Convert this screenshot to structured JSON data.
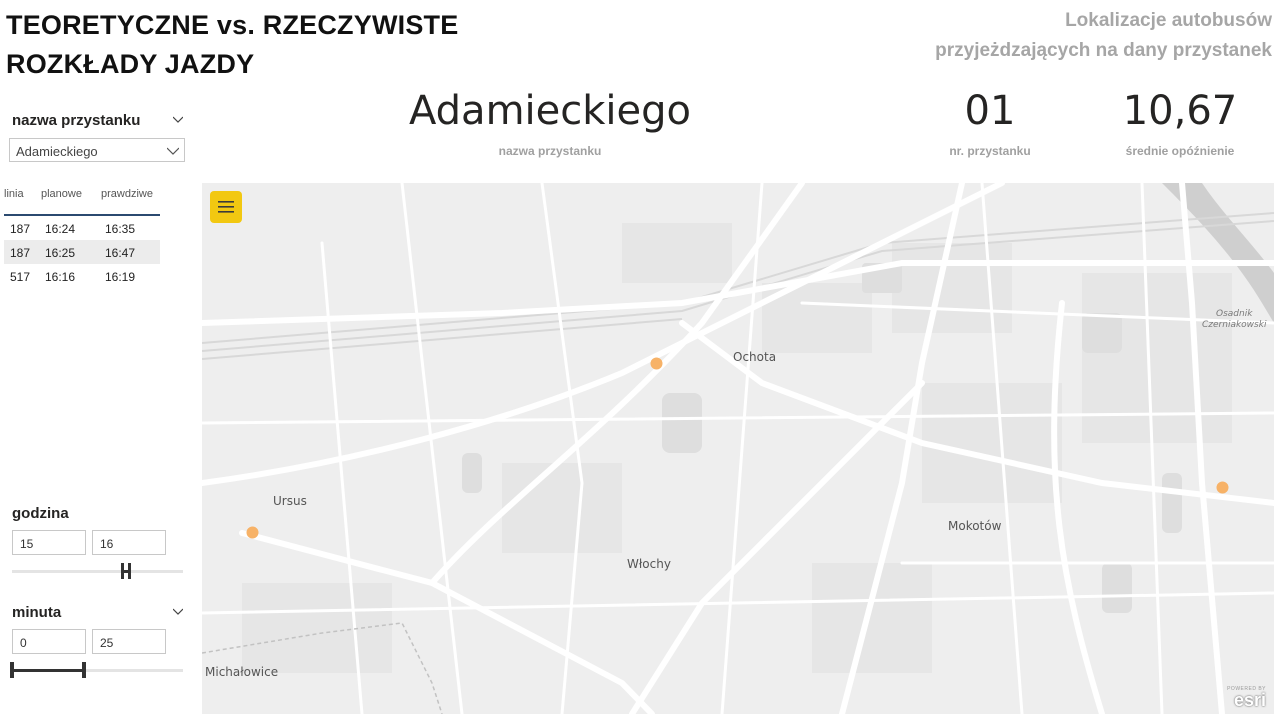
{
  "header": {
    "title_line1": "TEORETYCZNE vs. RZECZYWISTE",
    "title_line2": "ROZKŁADY JAZDY",
    "subtitle_line1": "Lokalizacje autobusów",
    "subtitle_line2": "przyjeżdzających na dany przystanek"
  },
  "stop_slicer": {
    "label": "nazwa przystanku",
    "selected": "Adamieckiego"
  },
  "schedule_table": {
    "columns": [
      "linia",
      "planowe",
      "prawdziwe"
    ],
    "rows": [
      [
        "187",
        "16:24",
        "16:35"
      ],
      [
        "187",
        "16:25",
        "16:47"
      ],
      [
        "517",
        "16:16",
        "16:19"
      ]
    ]
  },
  "hour_slicer": {
    "label": "godzina",
    "min": "15",
    "max": "16"
  },
  "minute_slicer": {
    "label": "minuta",
    "min": "0",
    "max": "25"
  },
  "kpis": {
    "stop_name": {
      "value": "Adamieckiego",
      "label": "nazwa przystanku"
    },
    "stop_number": {
      "value": "01",
      "label": "nr. przystanku"
    },
    "avg_delay": {
      "value": "10,67",
      "label": "średnie opóźnienie"
    }
  },
  "map": {
    "labels": {
      "ochota": "Ochota",
      "ursus": "Ursus",
      "wlochy": "Włochy",
      "mokotow": "Mokotów",
      "michalowice": "Michałowice",
      "osadnik_1": "Osadnik",
      "osadnik_2": "Czerniakowski"
    },
    "provider_small": "POWERED BY",
    "provider": "esri",
    "marker_color": "#f7b267",
    "menu_button_color": "#f2c811"
  }
}
